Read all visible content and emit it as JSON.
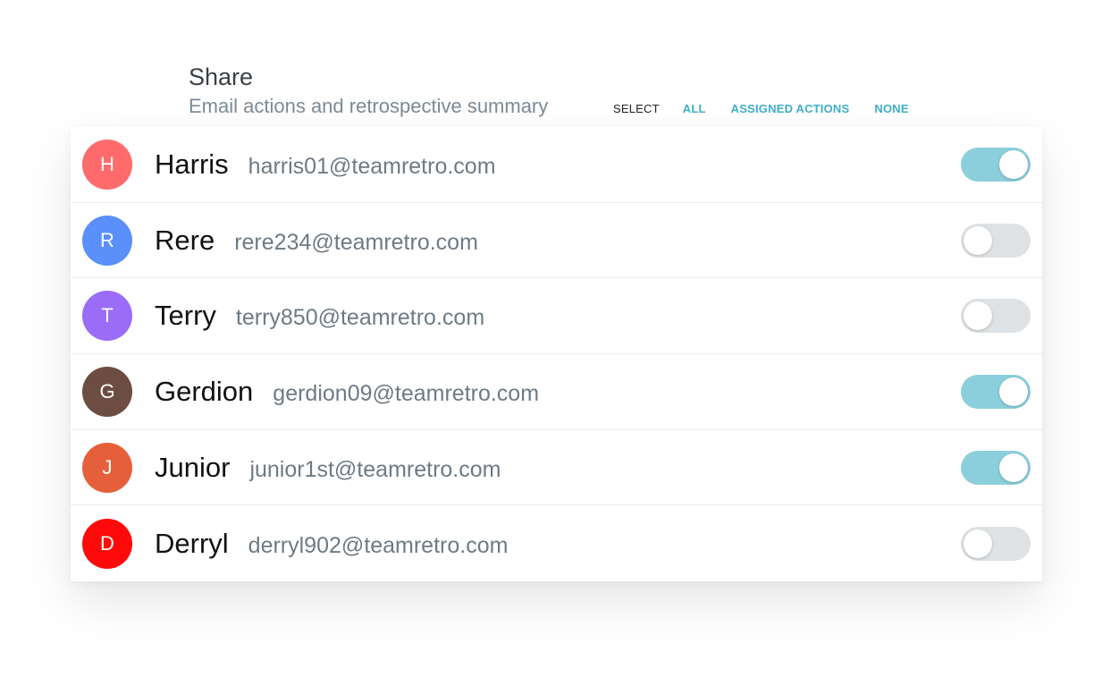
{
  "header": {
    "title": "Share",
    "subtitle": "Email actions and retrospective summary",
    "select_label": "SELECT",
    "select_options": [
      "ALL",
      "ASSIGNED ACTIONS",
      "NONE"
    ]
  },
  "colors": {
    "accent": "#3fb0c9",
    "toggle_on": "#8ccfdc",
    "toggle_off": "#dfe2e4"
  },
  "members": [
    {
      "initial": "H",
      "name": "Harris",
      "email": "harris01@teamretro.com",
      "avatar_color": "#ff6b6b",
      "shared": true
    },
    {
      "initial": "R",
      "name": "Rere",
      "email": "rere234@teamretro.com",
      "avatar_color": "#5b8ff9",
      "shared": false
    },
    {
      "initial": "T",
      "name": "Terry",
      "email": "terry850@teamretro.com",
      "avatar_color": "#9b6cf7",
      "shared": false
    },
    {
      "initial": "G",
      "name": "Gerdion",
      "email": "gerdion09@teamretro.com",
      "avatar_color": "#6d4d42",
      "shared": true
    },
    {
      "initial": "J",
      "name": "Junior",
      "email": "junior1st@teamretro.com",
      "avatar_color": "#e5603a",
      "shared": true
    },
    {
      "initial": "D",
      "name": "Derryl",
      "email": "derryl902@teamretro.com",
      "avatar_color": "#ff0a0a",
      "shared": false
    }
  ]
}
